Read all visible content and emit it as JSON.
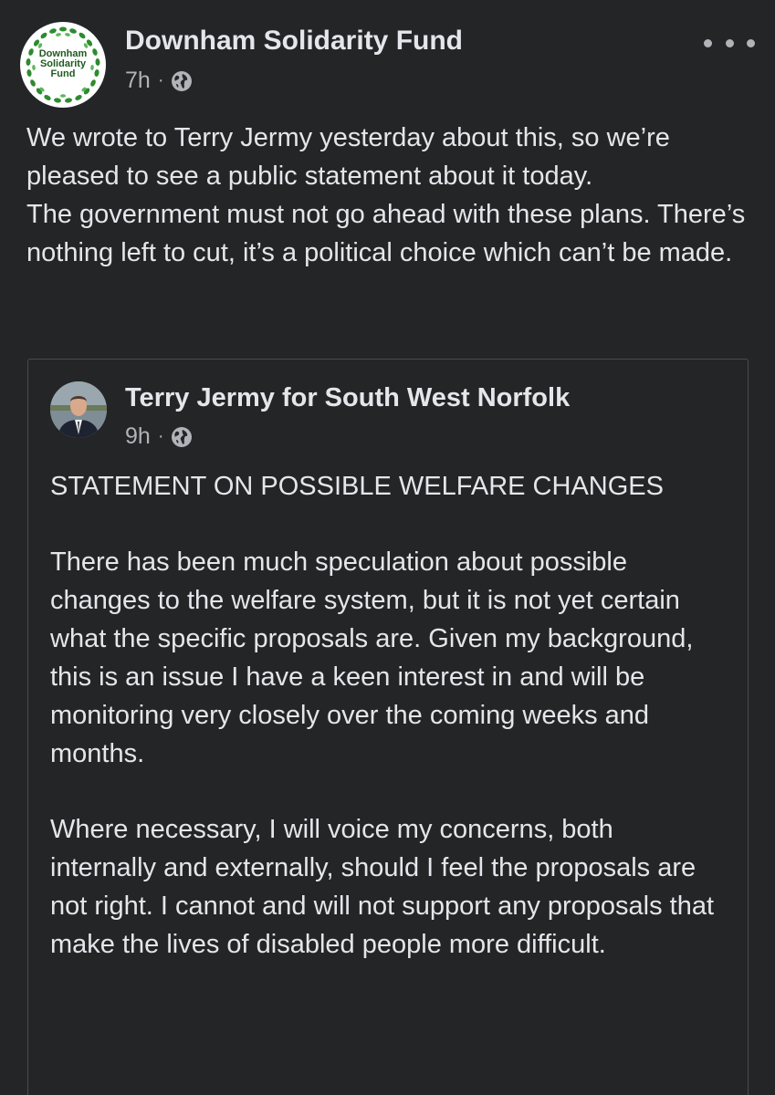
{
  "post": {
    "author": "Downham Solidarity Fund",
    "avatar_text": [
      "Downham",
      "Solidarity",
      "Fund"
    ],
    "time": "7h",
    "separator": "·",
    "visibility_icon": "globe-icon",
    "more_icon": "more-options-icon",
    "body": "We wrote to Terry Jermy yesterday about this, so we’re pleased to see a public statement about it today.\nThe government must not go ahead with these plans. There’s nothing left to cut, it’s a political choice which can’t be made."
  },
  "shared_post": {
    "author": "Terry Jermy for South West Norfolk",
    "time": "9h",
    "separator": "·",
    "visibility_icon": "globe-icon",
    "paragraphs": [
      "STATEMENT ON POSSIBLE WELFARE CHANGES",
      "There has been much speculation about possible changes to the welfare system, but it is not yet certain what the specific proposals are. Given my background, this is an issue I have a keen interest in and will be monitoring very closely over the coming weeks and months.",
      "Where necessary, I will voice my concerns, both internally and externally, should I feel the proposals are not right.  I cannot and will not support any proposals that make the lives of disabled people more difficult."
    ]
  },
  "colors": {
    "background": "#242526",
    "primary_text": "#e4e6eb",
    "secondary_text": "#b0b3b8",
    "border": "#4a4b4d",
    "logo_green": "#1e5a1e"
  }
}
